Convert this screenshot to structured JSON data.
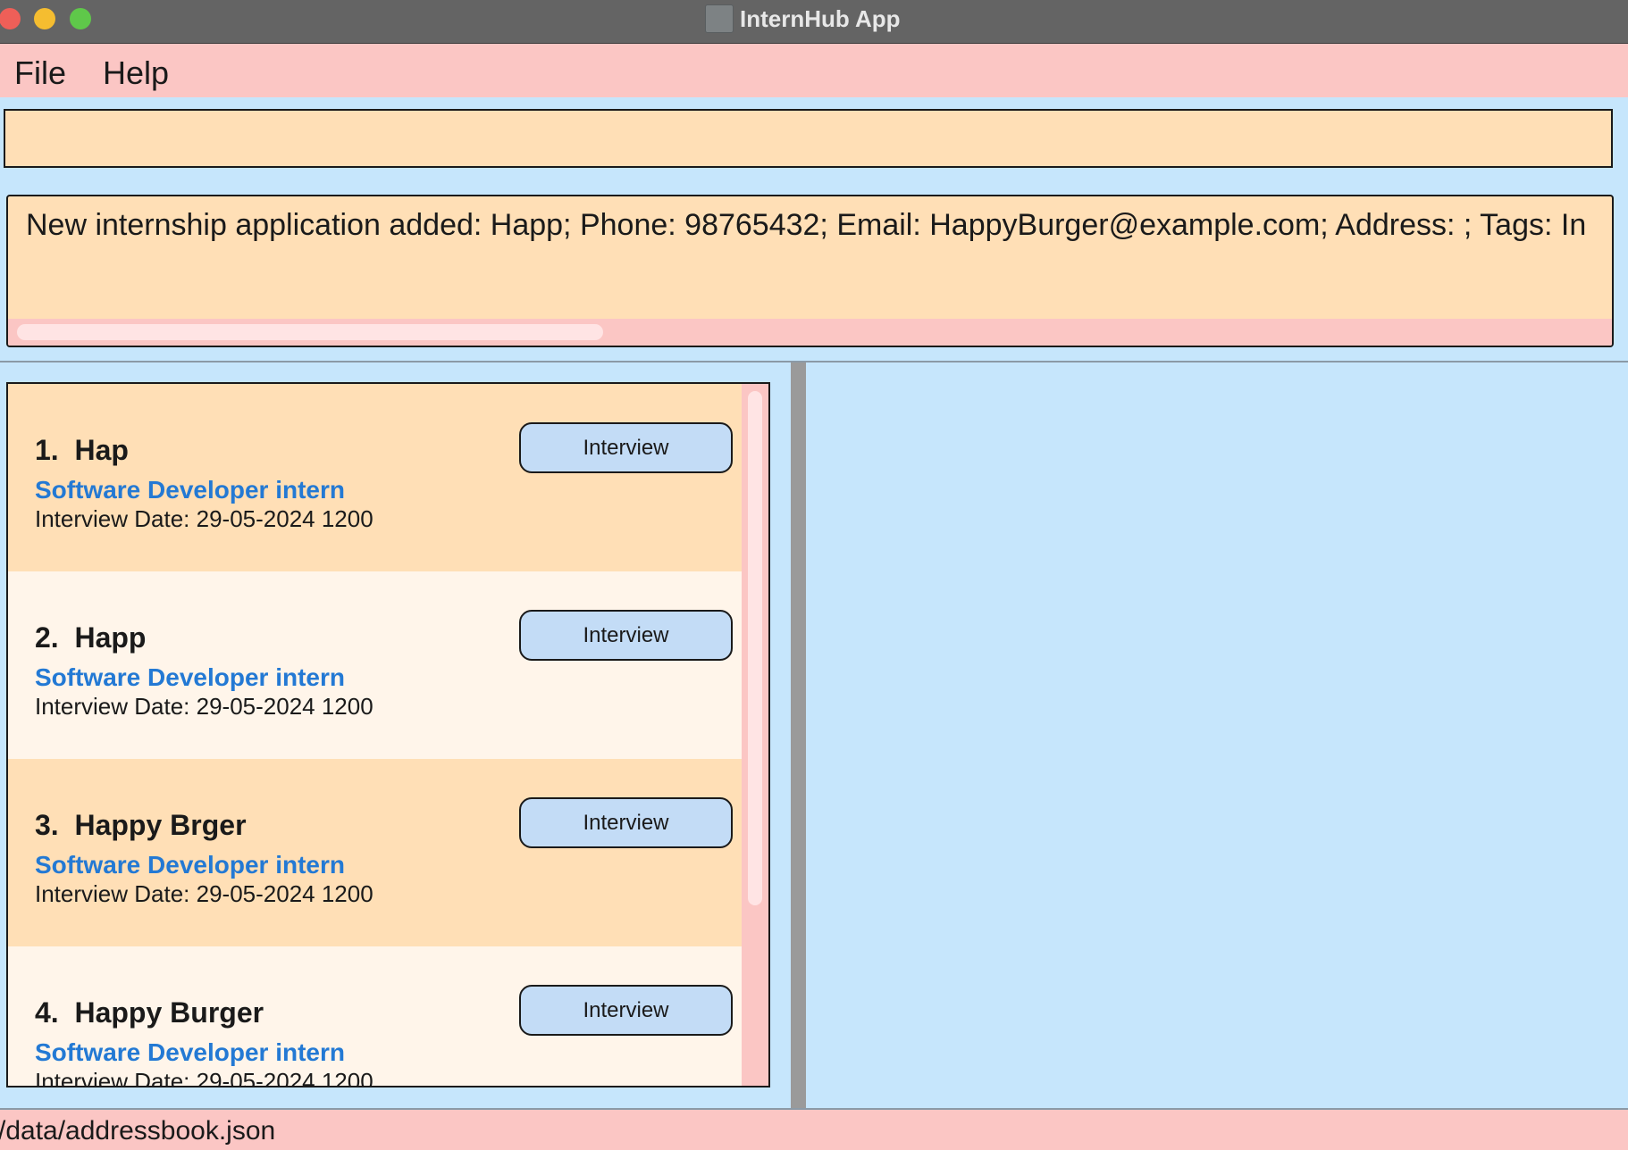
{
  "window": {
    "title": "InternHub App"
  },
  "menu": {
    "file_label": "File",
    "help_label": "Help"
  },
  "command": {
    "value": ""
  },
  "result": {
    "text": "New internship application added: Happ; Phone: 98765432; Email: HappyBurger@example.com; Address: ; Tags: In"
  },
  "applications": [
    {
      "index": "1.",
      "name": "Hap",
      "role": "Software Developer intern",
      "date": "Interview Date: 29-05-2024 1200",
      "status": "Interview"
    },
    {
      "index": "2.",
      "name": "Happ",
      "role": "Software Developer intern",
      "date": "Interview Date: 29-05-2024 1200",
      "status": "Interview"
    },
    {
      "index": "3.",
      "name": "Happy Brger",
      "role": "Software Developer intern",
      "date": "Interview Date: 29-05-2024 1200",
      "status": "Interview"
    },
    {
      "index": "4.",
      "name": "Happy Burger",
      "role": "Software Developer intern",
      "date": "Interview Date: 29-05-2024 1200",
      "status": "Interview"
    }
  ],
  "status_bar": {
    "path": "/data/addressbook.json"
  },
  "colors": {
    "menu_bg": "#fbc6c4",
    "app_bg": "#c6e6fc",
    "panel_bg": "#ffdfb6",
    "card_alt_bg": "#fff5ea",
    "role_text": "#2379d4",
    "status_button": "#c3dcf6"
  }
}
